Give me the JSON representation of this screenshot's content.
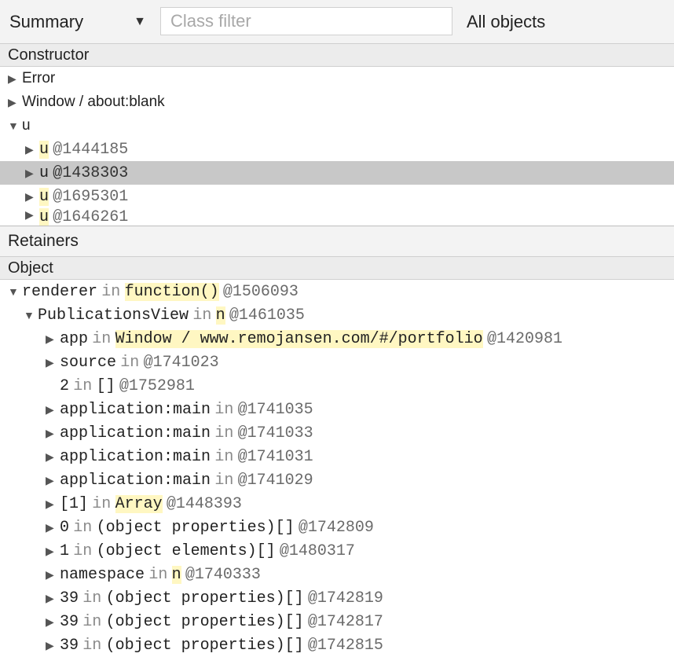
{
  "toolbar": {
    "view": "Summary",
    "filter_placeholder": "Class filter",
    "scope": "All objects"
  },
  "constructors": {
    "header": "Constructor",
    "rows": [
      {
        "tri": "▶",
        "name": "Error"
      },
      {
        "tri": "▶",
        "name": "Window / about:blank"
      },
      {
        "tri": "▼",
        "name": "u"
      }
    ],
    "children": [
      {
        "tri": "▶",
        "name": "u",
        "id": "@1444185"
      },
      {
        "tri": "▶",
        "name": "u",
        "id": "@1438303"
      },
      {
        "tri": "▶",
        "name": "u",
        "id": "@1695301"
      },
      {
        "tri": "▶",
        "name": "u",
        "id": "@1646261"
      }
    ]
  },
  "retainers": {
    "title": "Retainers",
    "header": "Object",
    "rows": [
      {
        "tri": "▼",
        "name": "renderer",
        "in": "in",
        "ctx": "function()",
        "id": "@1506093"
      },
      {
        "tri": "▼",
        "name": "PublicationsView",
        "in": "in",
        "ctx": "n",
        "id": "@1461035"
      },
      {
        "tri": "▶",
        "name": "app",
        "in": "in",
        "ctx": "Window / www.remojansen.com/#/portfolio",
        "id": "@1420981"
      },
      {
        "tri": "▶",
        "name": "source",
        "in": "in",
        "ctx": "",
        "id": "@1741023"
      },
      {
        "tri": "",
        "name": "2",
        "in": "in",
        "ctx": "[]",
        "id": "@1752981"
      },
      {
        "tri": "▶",
        "name": "application:main",
        "in": "in",
        "ctx": "",
        "id": "@1741035"
      },
      {
        "tri": "▶",
        "name": "application:main",
        "in": "in",
        "ctx": "",
        "id": "@1741033"
      },
      {
        "tri": "▶",
        "name": "application:main",
        "in": "in",
        "ctx": "",
        "id": "@1741031"
      },
      {
        "tri": "▶",
        "name": "application:main",
        "in": "in",
        "ctx": "",
        "id": "@1741029"
      },
      {
        "tri": "▶",
        "name": "[1]",
        "in": "in",
        "ctx": "Array",
        "id": "@1448393"
      },
      {
        "tri": "▶",
        "name": "0",
        "in": "in",
        "ctx": "(object properties)[]",
        "id": "@1742809"
      },
      {
        "tri": "▶",
        "name": "1",
        "in": "in",
        "ctx": "(object elements)[]",
        "id": "@1480317"
      },
      {
        "tri": "▶",
        "name": "namespace",
        "in": "in",
        "ctx": "n",
        "id": "@1740333"
      },
      {
        "tri": "▶",
        "name": "39",
        "in": "in",
        "ctx": "(object properties)[]",
        "id": "@1742819"
      },
      {
        "tri": "▶",
        "name": "39",
        "in": "in",
        "ctx": "(object properties)[]",
        "id": "@1742817"
      },
      {
        "tri": "▶",
        "name": "39",
        "in": "in",
        "ctx": "(object properties)[]",
        "id": "@1742815"
      }
    ]
  }
}
